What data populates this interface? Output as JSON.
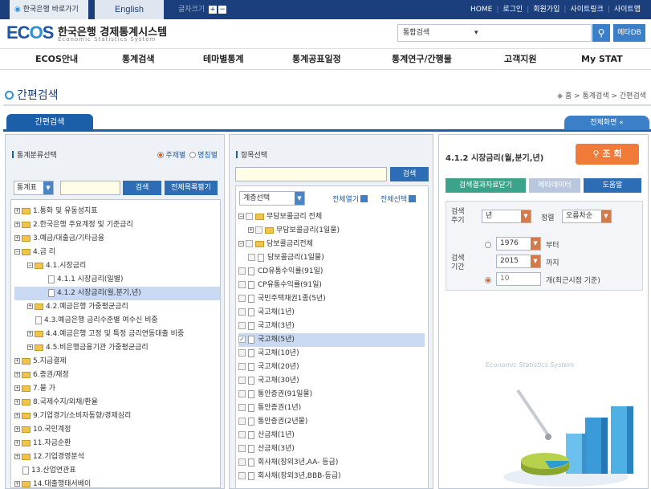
{
  "topbar": {
    "bok_link": "한국은행 바로가기",
    "english": "English",
    "font_size_label": "글자크기",
    "font_plus": "+",
    "font_minus": "−",
    "nav": [
      "HOME",
      "로그인",
      "회원가입",
      "사이트링크",
      "사이트맵"
    ]
  },
  "header": {
    "logo": "ECOS",
    "logo_o": "O",
    "title_ko": "한국은행 경제통계시스템",
    "title_en": "Economic Statistics System",
    "search_select": "통합검색",
    "search_icon": "search-icon",
    "meta_button": "메타DB"
  },
  "main_nav": [
    "ECOS안내",
    "통계검색",
    "테마별통계",
    "통계공표일정",
    "통계연구/간행물",
    "고객지원",
    "My STAT"
  ],
  "page": {
    "title": "간편검색",
    "breadcrumb": "홈 > 통계검색 > 간편검색"
  },
  "tabs": {
    "active": "간편검색",
    "fullscreen": "전체화면 «"
  },
  "panel1": {
    "heading": "통계분류선택",
    "radio_theme": "주제별",
    "radio_name": "명칭별",
    "table_select": "통계표",
    "search_btn": "검색",
    "toggle_btn": "전체목록펼기",
    "tree": [
      {
        "label": "1.통화 및 유동성지표",
        "depth": 0,
        "type": "folder",
        "pm": "+"
      },
      {
        "label": "2.한국은행 주요계정 및 기준금리",
        "depth": 0,
        "type": "folder",
        "pm": "+"
      },
      {
        "label": "3.예금/대출금/기타금융",
        "depth": 0,
        "type": "folder",
        "pm": "+"
      },
      {
        "label": "4.금 리",
        "depth": 0,
        "type": "folder",
        "pm": "−"
      },
      {
        "label": "4.1.시장금리",
        "depth": 1,
        "type": "folder",
        "pm": "−"
      },
      {
        "label": "4.1.1 시장금리(일별)",
        "depth": 2,
        "type": "doc"
      },
      {
        "label": "4.1.2 시장금리(월,분기,년)",
        "depth": 2,
        "type": "doc",
        "selected": true
      },
      {
        "label": "4.2.예금은행 가중평균금리",
        "depth": 1,
        "type": "folder",
        "pm": "+"
      },
      {
        "label": "4.3.예금은행 금리수준별 여수신 비중",
        "depth": 1,
        "type": "doc"
      },
      {
        "label": "4.4.예금은행 고정 및 특정 금리연동대출 비중",
        "depth": 1,
        "type": "folder",
        "pm": "+"
      },
      {
        "label": "4.5.비은행금융기관 가중평균금리",
        "depth": 1,
        "type": "folder",
        "pm": "+"
      },
      {
        "label": "5.지급결제",
        "depth": 0,
        "type": "folder",
        "pm": "+"
      },
      {
        "label": "6.증권/재정",
        "depth": 0,
        "type": "folder",
        "pm": "+"
      },
      {
        "label": "7.물 가",
        "depth": 0,
        "type": "folder",
        "pm": "+"
      },
      {
        "label": "8.국제수지/외채/환율",
        "depth": 0,
        "type": "folder",
        "pm": "+"
      },
      {
        "label": "9.기업경기/소비자동향/경제심리",
        "depth": 0,
        "type": "folder",
        "pm": "+"
      },
      {
        "label": "10.국민계정",
        "depth": 0,
        "type": "folder",
        "pm": "+"
      },
      {
        "label": "11.자금순환",
        "depth": 0,
        "type": "folder",
        "pm": "+"
      },
      {
        "label": "12.기업경영분석",
        "depth": 0,
        "type": "folder",
        "pm": "+"
      },
      {
        "label": "13.산업연관표",
        "depth": 0,
        "type": "doc"
      },
      {
        "label": "14.대출행태서베이",
        "depth": 0,
        "type": "folder",
        "pm": "+"
      }
    ]
  },
  "panel2": {
    "heading": "항목선택",
    "search_btn": "검색",
    "level_select": "계층선택",
    "expand_all": "전체열기",
    "select_all": "전체선택",
    "items": [
      {
        "label": "무담보콜금리 전체",
        "type": "group",
        "pm": "−"
      },
      {
        "label": "무담보콜금리(1일물)",
        "type": "subgroup",
        "pm": "+"
      },
      {
        "label": "담보콜금리전체",
        "type": "group",
        "pm": "−"
      },
      {
        "label": "담보콜금리(1일물)",
        "type": "subdoc"
      },
      {
        "label": "CD유통수익률(91일)",
        "type": "doc"
      },
      {
        "label": "CP유통수익률(91일)",
        "type": "doc"
      },
      {
        "label": "국민주택채권1종(5년)",
        "type": "doc"
      },
      {
        "label": "국고채(1년)",
        "type": "doc"
      },
      {
        "label": "국고채(3년)",
        "type": "doc"
      },
      {
        "label": "국고채(5년)",
        "type": "doc",
        "checked": true,
        "selected": true
      },
      {
        "label": "국고채(10년)",
        "type": "doc"
      },
      {
        "label": "국고채(20년)",
        "type": "doc"
      },
      {
        "label": "국고채(30년)",
        "type": "doc"
      },
      {
        "label": "통안증권(91일물)",
        "type": "doc"
      },
      {
        "label": "통안증권(1년)",
        "type": "doc"
      },
      {
        "label": "통안증권(2년물)",
        "type": "doc"
      },
      {
        "label": "산금채(1년)",
        "type": "doc"
      },
      {
        "label": "산금채(3년)",
        "type": "doc"
      },
      {
        "label": "회사채(장외3년,AA- 등급)",
        "type": "doc"
      },
      {
        "label": "회사채(장외3년,BBB-등급)",
        "type": "doc"
      }
    ]
  },
  "panel3": {
    "title": "4.1.2 시장금리(월,분기,년)",
    "query_btn": "조 회",
    "query_icon": "search-icon",
    "btn_close": "검색결과자료닫기",
    "btn_meta": "메타데이터",
    "btn_help": "도움말",
    "cycle_label": "검색주기",
    "cycle_value": "년",
    "sort_label": "정렬",
    "sort_value": "오름차순",
    "period_label": "검색기간",
    "start_year": "1976",
    "start_suffix": "부터",
    "end_year": "2015",
    "end_suffix": "까지",
    "recent_count": "10",
    "recent_suffix": "개(최근시점 기준)",
    "watermark": "Economic Statistics System"
  },
  "colors": {
    "topbar": "#1b3e7c",
    "accent": "#1a5fa8",
    "query": "#f07a38",
    "green_btn": "#3aa38a"
  }
}
